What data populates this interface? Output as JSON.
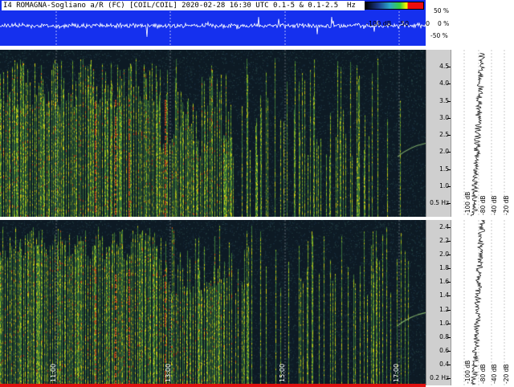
{
  "header": {
    "title": "I4 ROMAGNA-Sogliano a/R (FC) [COIL/COIL] 2020-02-28 16:30 UTC 0.1-5 & 0.1-2.5  Hz"
  },
  "colorbar": {
    "labels": [
      "-100 dB",
      "-50",
      "0"
    ],
    "colors": [
      "#000000",
      "#1a3a8a",
      "#2aa7c9",
      "#38d238",
      "#f4f000",
      "#ee0d0d"
    ]
  },
  "waveform": {
    "percent_labels": [
      "50 %",
      "0 %",
      "-50 %"
    ]
  },
  "spectrogram_top": {
    "y_ticks": [
      "4.5",
      "4.0",
      "3.5",
      "3.0",
      "2.5",
      "2.0",
      "1.5",
      "1.0",
      "0.5 Hz"
    ],
    "y_values": [
      4.5,
      4.0,
      3.5,
      3.0,
      2.5,
      2.0,
      1.5,
      1.0,
      0.5
    ],
    "ylim": [
      0.1,
      5.0
    ]
  },
  "spectrogram_bottom": {
    "y_ticks": [
      "2.4",
      "2.2",
      "2.0",
      "1.8",
      "1.6",
      "1.4",
      "1.2",
      "1.0",
      "0.8",
      "0.6",
      "0.4",
      "0.2 Hz"
    ],
    "y_values": [
      2.4,
      2.2,
      2.0,
      1.8,
      1.6,
      1.4,
      1.2,
      1.0,
      0.8,
      0.6,
      0.4,
      0.2
    ],
    "ylim": [
      0.1,
      2.5
    ]
  },
  "time_axis": {
    "labels": [
      "11:00",
      "13:00",
      "15:00",
      "17:00"
    ]
  },
  "level_axis": {
    "labels": [
      "-100 dB",
      "-80 dB",
      "-40 dB",
      "-20 dB"
    ]
  }
}
